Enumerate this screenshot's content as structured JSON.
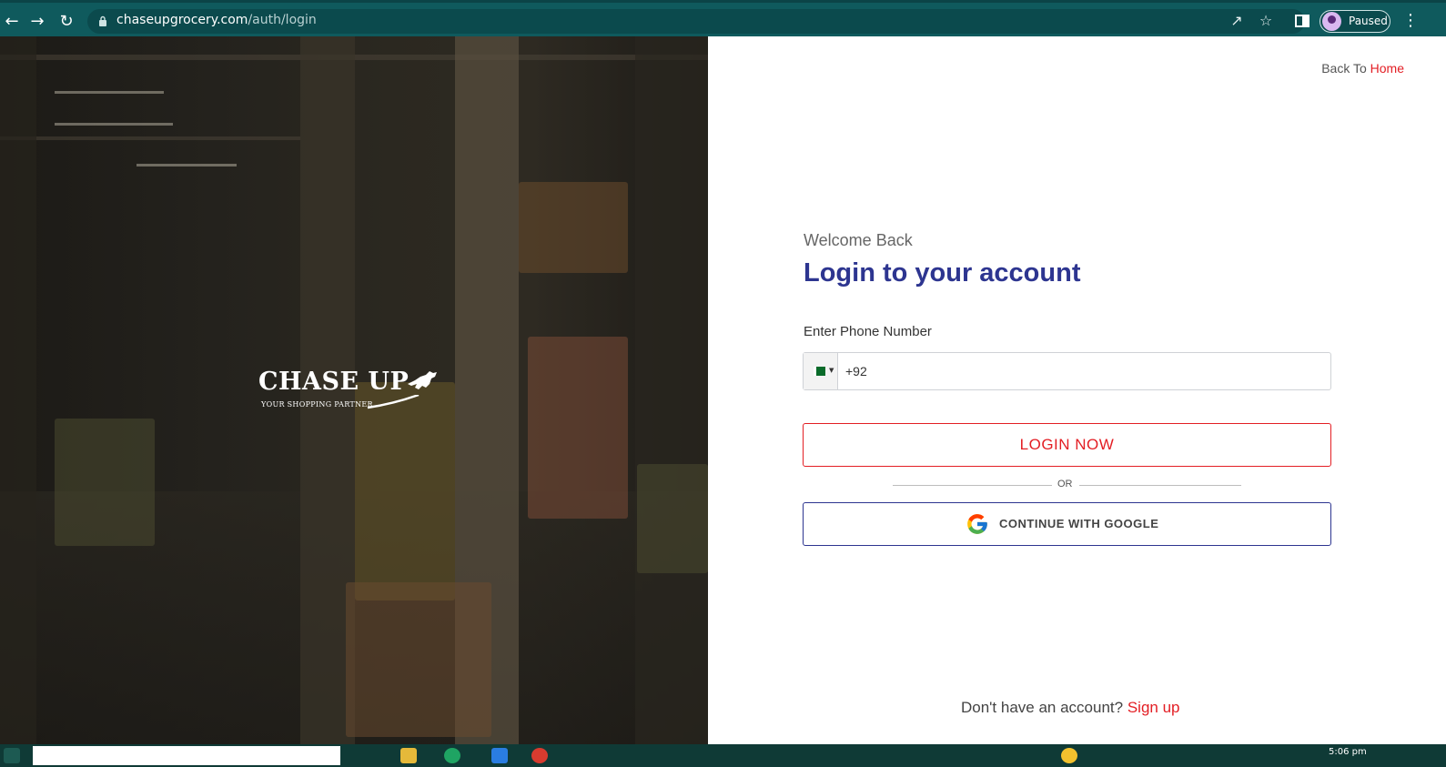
{
  "browser": {
    "url_domain": "chaseupgrocery.com",
    "url_path": "/auth/login",
    "profile_status": "Paused",
    "icons": [
      "back-arrow-icon",
      "forward-arrow-icon",
      "reload-icon",
      "lock-icon",
      "share-icon",
      "star-icon",
      "side-panel-icon",
      "kebab-menu-icon"
    ]
  },
  "hero": {
    "brand_name": "CHASE UP",
    "brand_tagline": "YOUR SHOPPING PARTNER"
  },
  "form": {
    "back_to_text": "Back To",
    "home_link": "Home",
    "welcome": "Welcome Back",
    "title": "Login to your account",
    "phone_label": "Enter Phone Number",
    "phone_value": "+92",
    "login_button": "LOGIN NOW",
    "or_text": "OR",
    "google_button": "CONTINUE WITH GOOGLE",
    "signup_prompt": "Don't have an account?",
    "signup_link": "Sign up"
  },
  "taskbar": {
    "clock": "5:06 pm"
  },
  "colors": {
    "brand_red": "#e31e24",
    "brand_navy": "#2d3590",
    "chrome_teal": "#0f5a5d"
  }
}
